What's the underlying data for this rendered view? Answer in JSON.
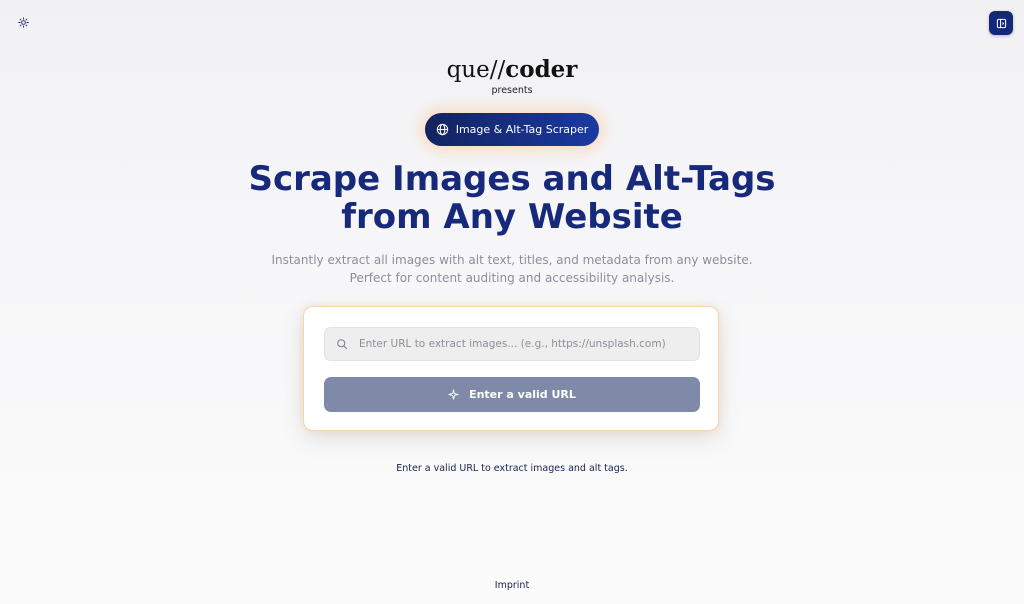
{
  "header": {
    "theme_icon": "sun-icon",
    "sidebar_icon": "panel-toggle-icon"
  },
  "brand": {
    "prefix": "que//",
    "suffix": "coder",
    "presents": "presents"
  },
  "badge": {
    "icon": "globe-icon",
    "label": "Image & Alt-Tag Scraper"
  },
  "hero": {
    "title_line1": "Scrape Images and Alt-Tags",
    "title_line2": "from Any Website",
    "subtitle_line1": "Instantly extract all images with alt text, titles, and metadata from any website.",
    "subtitle_line2": "Perfect for content auditing and accessibility analysis."
  },
  "form": {
    "search_icon": "search-icon",
    "url_value": "",
    "url_placeholder": "Enter URL to extract images... (e.g., https://unsplash.com)",
    "button_icon": "sparkle-icon",
    "button_label": "Enter a valid URL",
    "helper_text": "Enter a valid URL to extract images and alt tags."
  },
  "footer": {
    "imprint_label": "Imprint"
  },
  "colors": {
    "navy": "#17297a",
    "badge_gradient_start": "#13235f",
    "badge_gradient_end": "#1a3aa3",
    "button_disabled": "#7f89a8",
    "card_border": "#f6d6ad",
    "subtitle_gray": "#8a8f9c"
  }
}
